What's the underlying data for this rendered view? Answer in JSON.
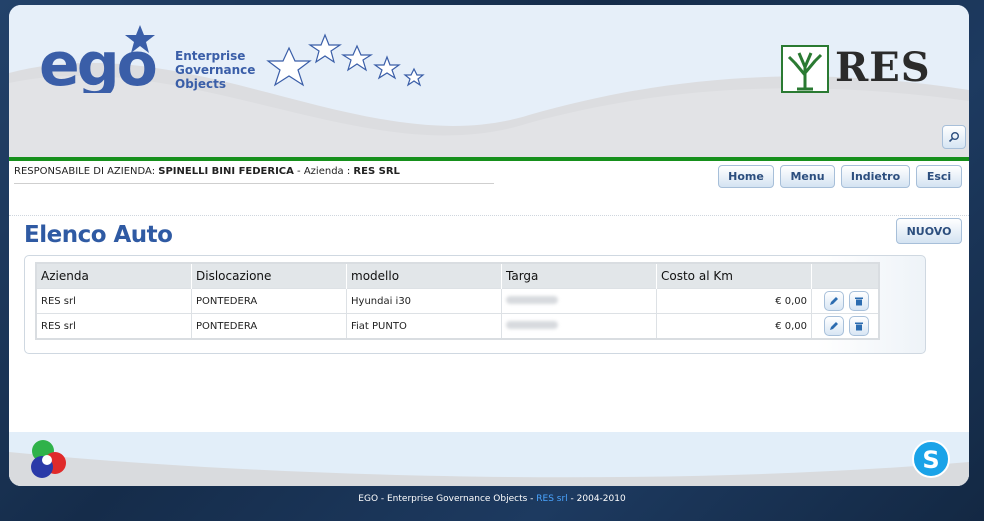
{
  "header": {
    "logo_text": "ego",
    "tagline": [
      "Enterprise",
      "Governance",
      "Objects"
    ],
    "partner": "RES",
    "search_icon": "search-icon"
  },
  "user": {
    "role_prefix": "RESPONSABILE DI AZIENDA: ",
    "name": "SPINELLI BINI FEDERICA",
    "company_prefix": " - Azienda : ",
    "company": "RES SRL"
  },
  "nav": {
    "home": "Home",
    "menu": "Menu",
    "back": "Indietro",
    "exit": "Esci"
  },
  "page": {
    "title": "Elenco Auto",
    "new_label": "NUOVO"
  },
  "table": {
    "columns": [
      "Azienda",
      "Dislocazione",
      "modello",
      "Targa",
      "Costo al Km",
      ""
    ],
    "rows": [
      {
        "azienda": "RES srl",
        "dislocazione": "PONTEDERA",
        "modello": "Hyundai i30",
        "costo": "€ 0,00"
      },
      {
        "azienda": "RES srl",
        "dislocazione": "PONTEDERA",
        "modello": "Fiat PUNTO",
        "costo": "€ 0,00"
      }
    ],
    "edit_icon": "pencil-icon",
    "delete_icon": "trash-icon"
  },
  "footer": {
    "text_before": "EGO - Enterprise Governance Objects - ",
    "link": "RES srl",
    "text_after": " - 2004-2010"
  },
  "colors": {
    "brand_blue": "#3a5ea8",
    "green_bar": "#16901c",
    "title_blue": "#2f5aa3"
  }
}
